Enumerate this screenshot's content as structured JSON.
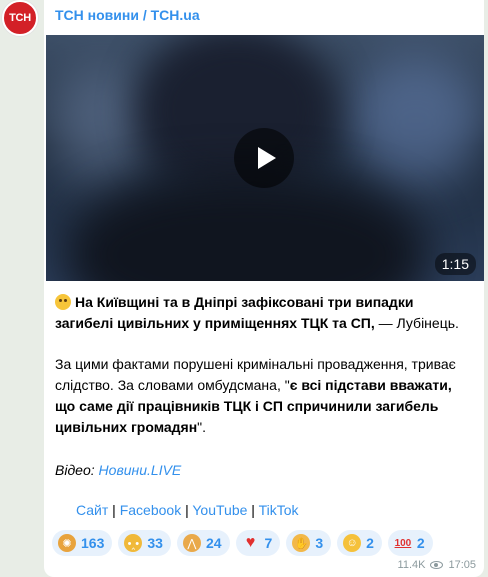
{
  "channel": {
    "name": "ТСН новини / TCH.ua",
    "avatar_text": "ТСН"
  },
  "video": {
    "duration": "1:15"
  },
  "post": {
    "headline_bold": "На Київщині та в Дніпрі зафіксовані три випадки загибелі цивільних у приміщеннях ТЦК та СП,",
    "headline_tail": " — Лубінець.",
    "para_intro": "За цими фактами порушені кримінальні провадження, триває слідство. За словами омбудсмана, \"",
    "para_bold": "є всі підстави вважати, що саме дії працівників ТЦК і СП спричинили загибель цивільних громадян",
    "para_end": "\".",
    "video_label": "Відео: ",
    "video_link": "Новини.LIVE",
    "links": [
      "Сайт",
      "Facebook",
      "YouTube",
      "TikTok"
    ],
    "separator": " | "
  },
  "reactions": [
    {
      "icon": "exploding-head-icon",
      "count": "163",
      "color": "#e8a33d"
    },
    {
      "icon": "crying-face-icon",
      "count": "33",
      "color": "#f0b93a"
    },
    {
      "icon": "praying-hands-icon",
      "count": "24",
      "color": "#e9a94b"
    },
    {
      "icon": "heart-icon",
      "count": "7",
      "color": "#e2302f"
    },
    {
      "icon": "clapping-hands-icon",
      "count": "3",
      "color": "#f2b84a"
    },
    {
      "icon": "grinning-face-icon",
      "count": "2",
      "color": "#f5c13b"
    },
    {
      "icon": "hundred-points-icon",
      "count": "2",
      "color": "#e0302f"
    }
  ],
  "meta": {
    "views": "11.4K",
    "time": "17:05"
  },
  "colors": {
    "accent": "#3390ec",
    "avatar_bg": "#d32027",
    "reaction_bg": "#e7f1fc"
  }
}
